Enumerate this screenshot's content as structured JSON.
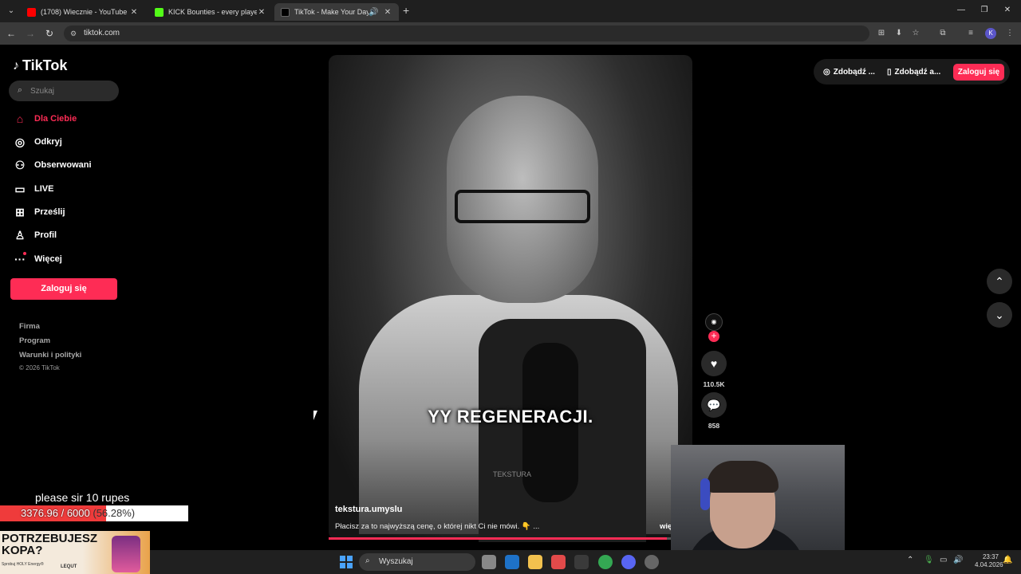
{
  "browser": {
    "tabs": [
      {
        "title": "(1708) Wiecznie - YouTube",
        "favicon_color": "#ff0000"
      },
      {
        "title": "KICK Bounties - every player fo",
        "favicon_color": "#53fc18"
      },
      {
        "title": "TikTok - Make Your Day",
        "favicon_color": "#000000",
        "active": true
      }
    ],
    "url": "tiktok.com"
  },
  "tiktok": {
    "logo": "TikTok",
    "search_placeholder": "Szukaj",
    "nav": [
      {
        "label": "Dla Ciebie",
        "icon": "home-icon",
        "active": true
      },
      {
        "label": "Odkryj",
        "icon": "compass-icon"
      },
      {
        "label": "Obserwowani",
        "icon": "user-plus-icon"
      },
      {
        "label": "LIVE",
        "icon": "live-tv-icon"
      },
      {
        "label": "Prześlij",
        "icon": "upload-icon"
      },
      {
        "label": "Profil",
        "icon": "profile-icon"
      },
      {
        "label": "Więcej",
        "icon": "more-icon"
      }
    ],
    "login_button": "Zaloguj się",
    "footer_links": [
      "Firma",
      "Program",
      "Warunki i polityki"
    ],
    "copyright": "© 2026 TikTok",
    "header": {
      "get_coins": "Zdobądź ...",
      "get_app": "Zdobądź a...",
      "login": "Zaloguj się"
    },
    "video": {
      "caption": "YY REGENERACJI.",
      "watermark": "TEKSTURA",
      "author": "tekstura.umyslu",
      "description": "Płacisz za to najwyższą cenę, o której nikt Ci nie mówi. 👇 ...",
      "more": "wię",
      "progress": 0.93
    },
    "actions": {
      "likes": "110.5K",
      "comments": "858"
    },
    "accent": "#fe2c55"
  },
  "stream": {
    "goal_text": "please sir 10 rupes",
    "goal_value": "3376.96 / 6000",
    "goal_percent": "(56.28%)",
    "goal_fraction": 0.5628,
    "ad_title": "POTRZEBUJESZ KOPA?",
    "ad_small": "Sprobuj HOLY Energy®",
    "ad_brand": "LEQUT"
  },
  "taskbar": {
    "search_placeholder": "Wyszukaj",
    "time": "23:37",
    "date": "4.04.2026"
  }
}
